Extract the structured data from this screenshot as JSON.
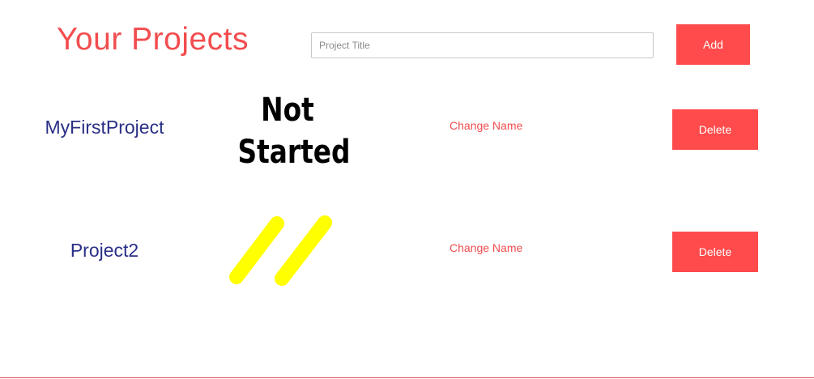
{
  "header": {
    "title": "Your Projects",
    "input_placeholder": "Project Title",
    "input_value": "",
    "add_label": "Add"
  },
  "projects": [
    {
      "name": "MyFirstProject",
      "status": "Not Started",
      "change_label": "Change Name",
      "delete_label": "Delete"
    },
    {
      "name": "Project2",
      "status_icon": "yellow-double-stroke-icon",
      "change_label": "Change Name",
      "delete_label": "Delete"
    }
  ],
  "colors": {
    "accent": "#ff4b4b",
    "title": "#f24d4f",
    "project_name": "#2a2f86",
    "status_stroke": "#ffff00"
  }
}
